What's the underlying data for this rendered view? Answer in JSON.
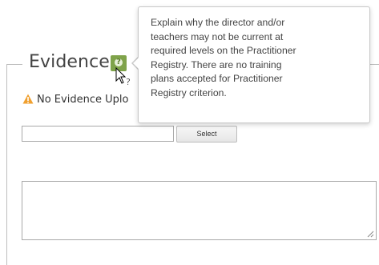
{
  "section": {
    "legend": "Evidence",
    "help_icon": "question-icon",
    "warning_icon": "warning-triangle-icon",
    "warning_text": "No Evidence Uplo"
  },
  "upload": {
    "file_value": "",
    "select_label": "Select"
  },
  "comments": {
    "value": ""
  },
  "tooltip": {
    "lines": [
      "Explain why the director and/or",
      "teachers may not be current at",
      "required levels on the Practitioner",
      "Registry. There are no training",
      "plans accepted for Practitioner",
      "Registry criterion."
    ]
  },
  "colors": {
    "help_icon_bg": "#7fa34a",
    "warning_icon": "#f0a030",
    "frame": "#bdbdbd"
  }
}
